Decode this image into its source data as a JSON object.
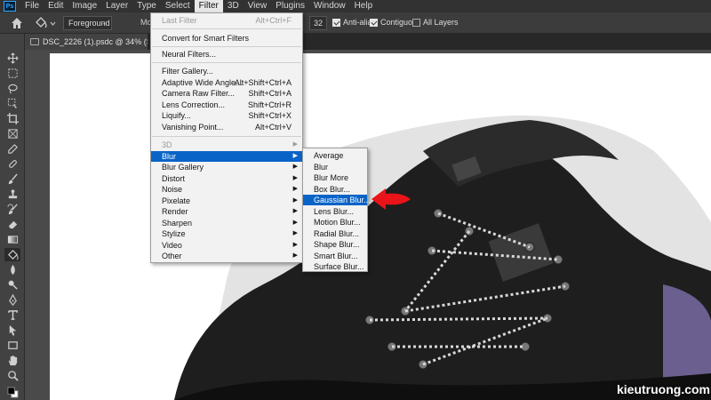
{
  "app": {
    "logo": "Ps"
  },
  "menubar": {
    "items": [
      "File",
      "Edit",
      "Image",
      "Layer",
      "Type",
      "Select",
      "Filter",
      "3D",
      "View",
      "Plugins",
      "Window",
      "Help"
    ],
    "active": "Filter"
  },
  "options": {
    "fill_source": "Foreground",
    "mode_label": "Mo",
    "tolerance": "32",
    "anti_alias": {
      "label": "Anti-alias",
      "checked": true
    },
    "contiguous": {
      "label": "Contiguous",
      "checked": true
    },
    "all_layers": {
      "label": "All Layers",
      "checked": false
    }
  },
  "document": {
    "tab_title": "DSC_2226 (1).psdc @ 34% (Shadow,"
  },
  "filter_menu": {
    "last_filter": {
      "label": "Last Filter",
      "shortcut": "Alt+Ctrl+F"
    },
    "convert": "Convert for Smart Filters",
    "neural": "Neural Filters...",
    "gallery": [
      {
        "label": "Filter Gallery...",
        "shortcut": ""
      },
      {
        "label": "Adaptive Wide Angle...",
        "shortcut": "Alt+Shift+Ctrl+A"
      },
      {
        "label": "Camera Raw Filter...",
        "shortcut": "Shift+Ctrl+A"
      },
      {
        "label": "Lens Correction...",
        "shortcut": "Shift+Ctrl+R"
      },
      {
        "label": "Liquify...",
        "shortcut": "Shift+Ctrl+X"
      },
      {
        "label": "Vanishing Point...",
        "shortcut": "Alt+Ctrl+V"
      }
    ],
    "submenus": [
      "3D",
      "Blur",
      "Blur Gallery",
      "Distort",
      "Noise",
      "Pixelate",
      "Render",
      "Sharpen",
      "Stylize",
      "Video",
      "Other"
    ],
    "highlighted": "Blur"
  },
  "blur_menu": {
    "items": [
      "Average",
      "Blur",
      "Blur More",
      "Box Blur...",
      "Gaussian Blur...",
      "Lens Blur...",
      "Motion Blur...",
      "Radial Blur...",
      "Shape Blur...",
      "Smart Blur...",
      "Surface Blur..."
    ],
    "highlighted": "Gaussian Blur..."
  },
  "watermark": "kieutruong.com",
  "colors": {
    "highlight": "#0a64c8",
    "arrow": "#e8141a",
    "menubar": "#323232",
    "panel": "#424242"
  }
}
